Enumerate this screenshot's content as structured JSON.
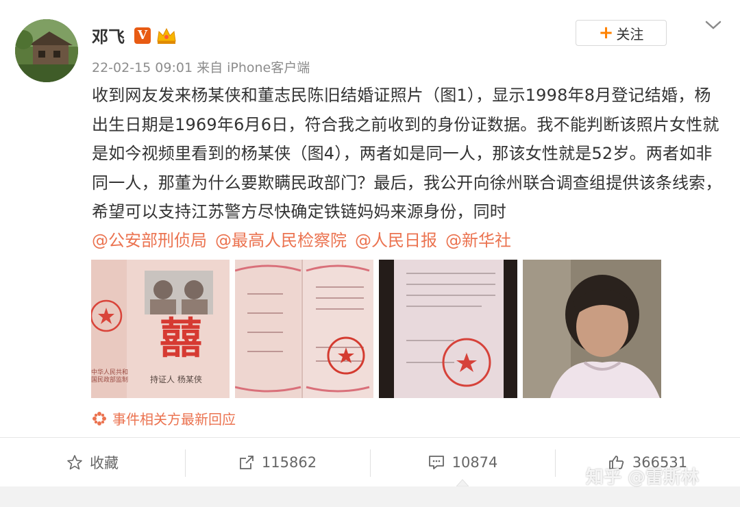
{
  "post": {
    "username": "邓飞",
    "verified_badge": "V",
    "meta": "22-02-15 09:01 来自 iPhone客户端",
    "follow_label": "关注",
    "follow_plus": "+",
    "content": "收到网友发来杨某侠和董志民陈旧结婚证照片（图1），显示1998年8月登记结婚，杨出生日期是1969年6月6日，符合我之前收到的身份证数据。我不能判断该照片女性就是如今视频里看到的杨某侠（图4），两者如是同一人，那该女性就是52岁。两者如非同一人，那董为什么要欺瞒民政部门？最后，我公开向徐州联合调查组提供该条线索，希望可以支持江苏警方尽快确定铁链妈妈来源身份，同时",
    "mentions": [
      "@公安部刑侦局",
      "@最高人民检察院",
      "@人民日报",
      "@新华社"
    ],
    "photo1_stamp": "囍",
    "photo1_sign": "持证人 杨某侠",
    "photo1_side": "中华人民共和国民政部监制",
    "event_link": "事件相关方最新回应"
  },
  "actions": {
    "favorite": "收藏",
    "repost": "115862",
    "comment": "10874",
    "like": "366531"
  },
  "watermark": "知乎 @雷斯林",
  "colors": {
    "accent": "#eb7350",
    "follow_plus": "#ff8200",
    "badge": "#e85b13"
  }
}
